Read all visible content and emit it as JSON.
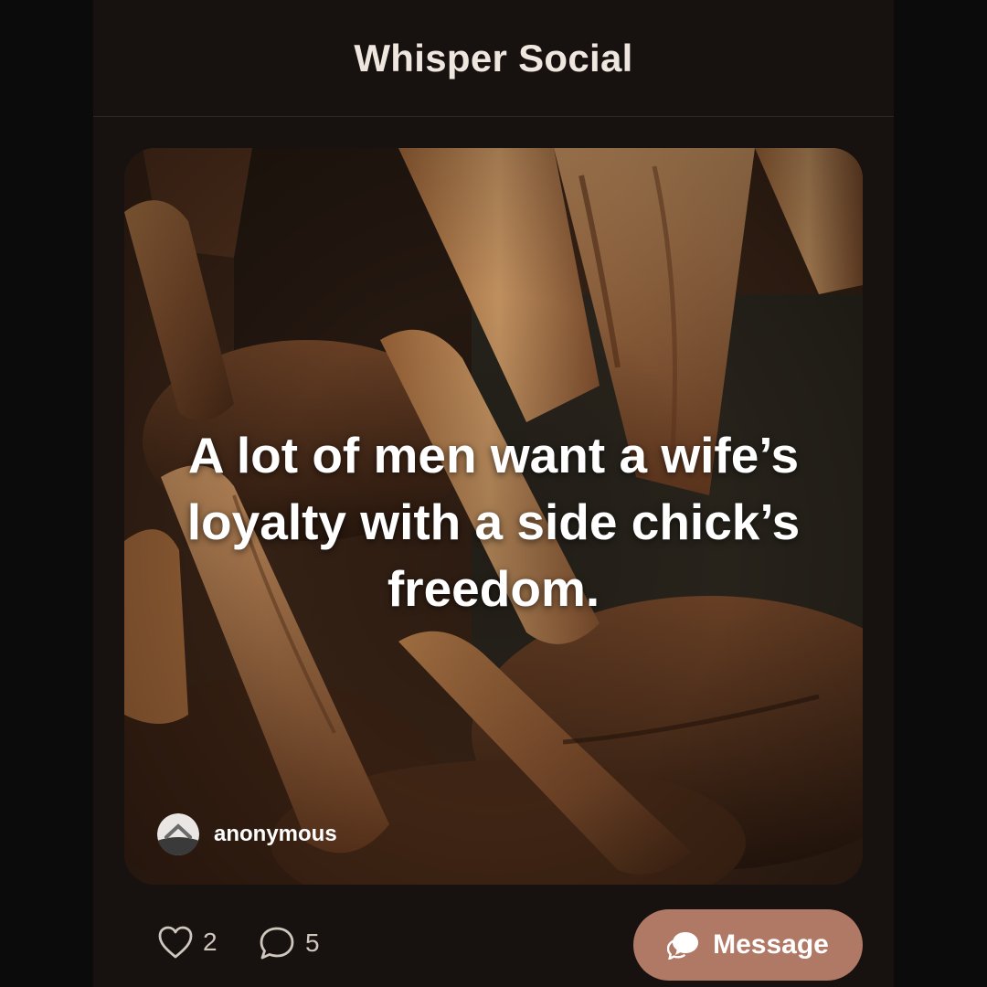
{
  "header": {
    "title": "Whisper Social"
  },
  "post": {
    "quote": "A lot of men want a wife’s loyalty with a side chick’s freedom.",
    "author": "anonymous",
    "background": "olive-wood-utensils-photo"
  },
  "actions": {
    "likes": "2",
    "comments": "5",
    "message_label": "Message"
  },
  "icons": {
    "like": "heart-icon",
    "comment": "comment-bubble-icon",
    "message": "chat-bubbles-icon",
    "avatar": "anonymous-avatar-icon"
  },
  "colors": {
    "background": "#17120f",
    "message_button": "#b07966",
    "text_primary": "#efe7df"
  }
}
